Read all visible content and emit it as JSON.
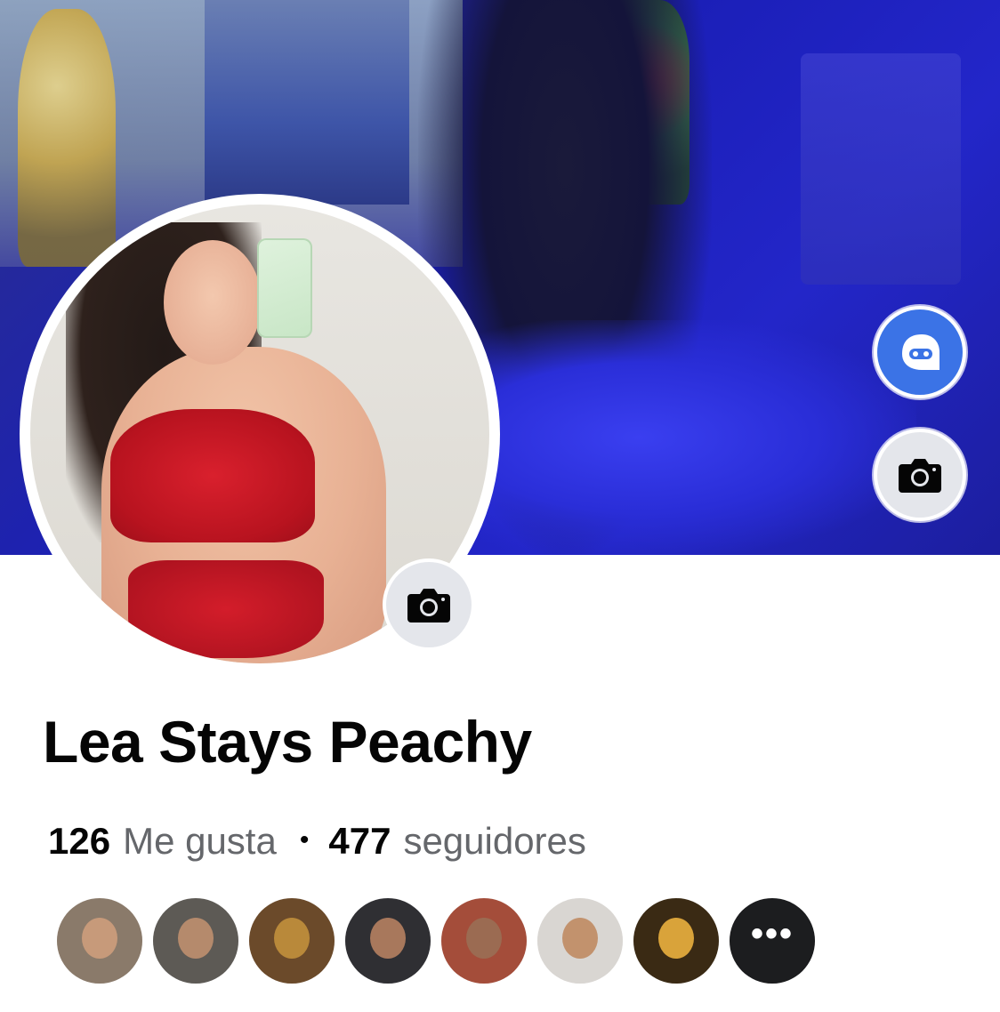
{
  "profile": {
    "name": "Lea Stays Peachy",
    "likes_count": "126",
    "likes_label": "Me gusta",
    "separator": "•",
    "followers_count": "477",
    "followers_label": "seguidores"
  },
  "cover": {
    "accent": "#2326c9"
  },
  "actions": {
    "avatar_button_color": "#3b73e6",
    "cover_camera_icon": "camera-icon",
    "profile_camera_icon": "camera-icon",
    "avatar_icon": "avatar-icon"
  },
  "followers_preview": {
    "more_label": "•••",
    "items": [
      {
        "name": "follower-1",
        "bg": "#8a7a6a",
        "head": "#c79a7a"
      },
      {
        "name": "follower-2",
        "bg": "#5d5a55",
        "head": "#b58a6c"
      },
      {
        "name": "follower-3",
        "bg": "#6b4a2a",
        "head": "#b9893a"
      },
      {
        "name": "follower-4",
        "bg": "#2f2f33",
        "head": "#a8785c"
      },
      {
        "name": "follower-5",
        "bg": "#a44d3a",
        "head": "#9b6b52"
      },
      {
        "name": "follower-6",
        "bg": "#d9d6d2",
        "head": "#c2926d"
      },
      {
        "name": "follower-7",
        "bg": "#3a2a14",
        "head": "#d9a33a"
      }
    ]
  }
}
